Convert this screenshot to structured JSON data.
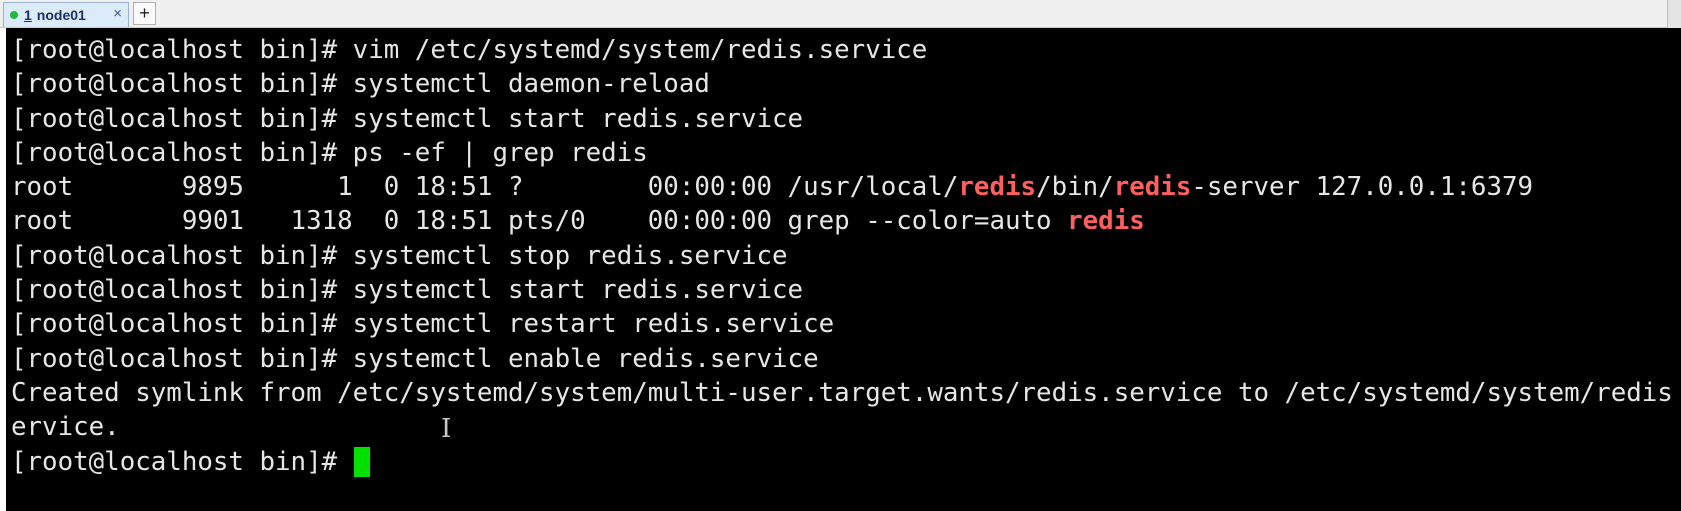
{
  "tabbar": {
    "tab": {
      "number": "1",
      "name": "node01",
      "close": "×"
    },
    "add": "+"
  },
  "terminal": {
    "lines": [
      {
        "parts": [
          {
            "t": "[root@localhost bin]# vim /etc/systemd/system/redis.service"
          }
        ]
      },
      {
        "parts": [
          {
            "t": "[root@localhost bin]# systemctl daemon-reload"
          }
        ]
      },
      {
        "parts": [
          {
            "t": "[root@localhost bin]# systemctl start redis.service"
          }
        ]
      },
      {
        "parts": [
          {
            "t": "[root@localhost bin]# ps -ef | grep redis"
          }
        ]
      },
      {
        "parts": [
          {
            "t": "root       9895      1  0 18:51 ?        00:00:00 /usr/local/"
          },
          {
            "t": "redis",
            "hl": true
          },
          {
            "t": "/bin/"
          },
          {
            "t": "redis",
            "hl": true
          },
          {
            "t": "-server 127.0.0.1:6379"
          }
        ]
      },
      {
        "parts": [
          {
            "t": "root       9901   1318  0 18:51 pts/0    00:00:00 grep --color=auto "
          },
          {
            "t": "redis",
            "hl": true
          }
        ]
      },
      {
        "parts": [
          {
            "t": "[root@localhost bin]# systemctl stop redis.service"
          }
        ]
      },
      {
        "parts": [
          {
            "t": "[root@localhost bin]# systemctl start redis.service"
          }
        ]
      },
      {
        "parts": [
          {
            "t": "[root@localhost bin]# systemctl restart redis.service"
          }
        ]
      },
      {
        "parts": [
          {
            "t": "[root@localhost bin]# systemctl enable redis.service"
          }
        ]
      },
      {
        "parts": [
          {
            "t": "Created symlink from /etc/systemd/system/multi-user.target.wants/redis.service to /etc/systemd/system/redis"
          }
        ]
      },
      {
        "parts": [
          {
            "t": "ervice."
          }
        ]
      },
      {
        "parts": [
          {
            "t": "[root@localhost bin]# "
          }
        ],
        "cursor": true
      }
    ],
    "highlight_color": "#ff5f5f",
    "cursor_color": "#00e000",
    "pointer_glyph": "I"
  }
}
